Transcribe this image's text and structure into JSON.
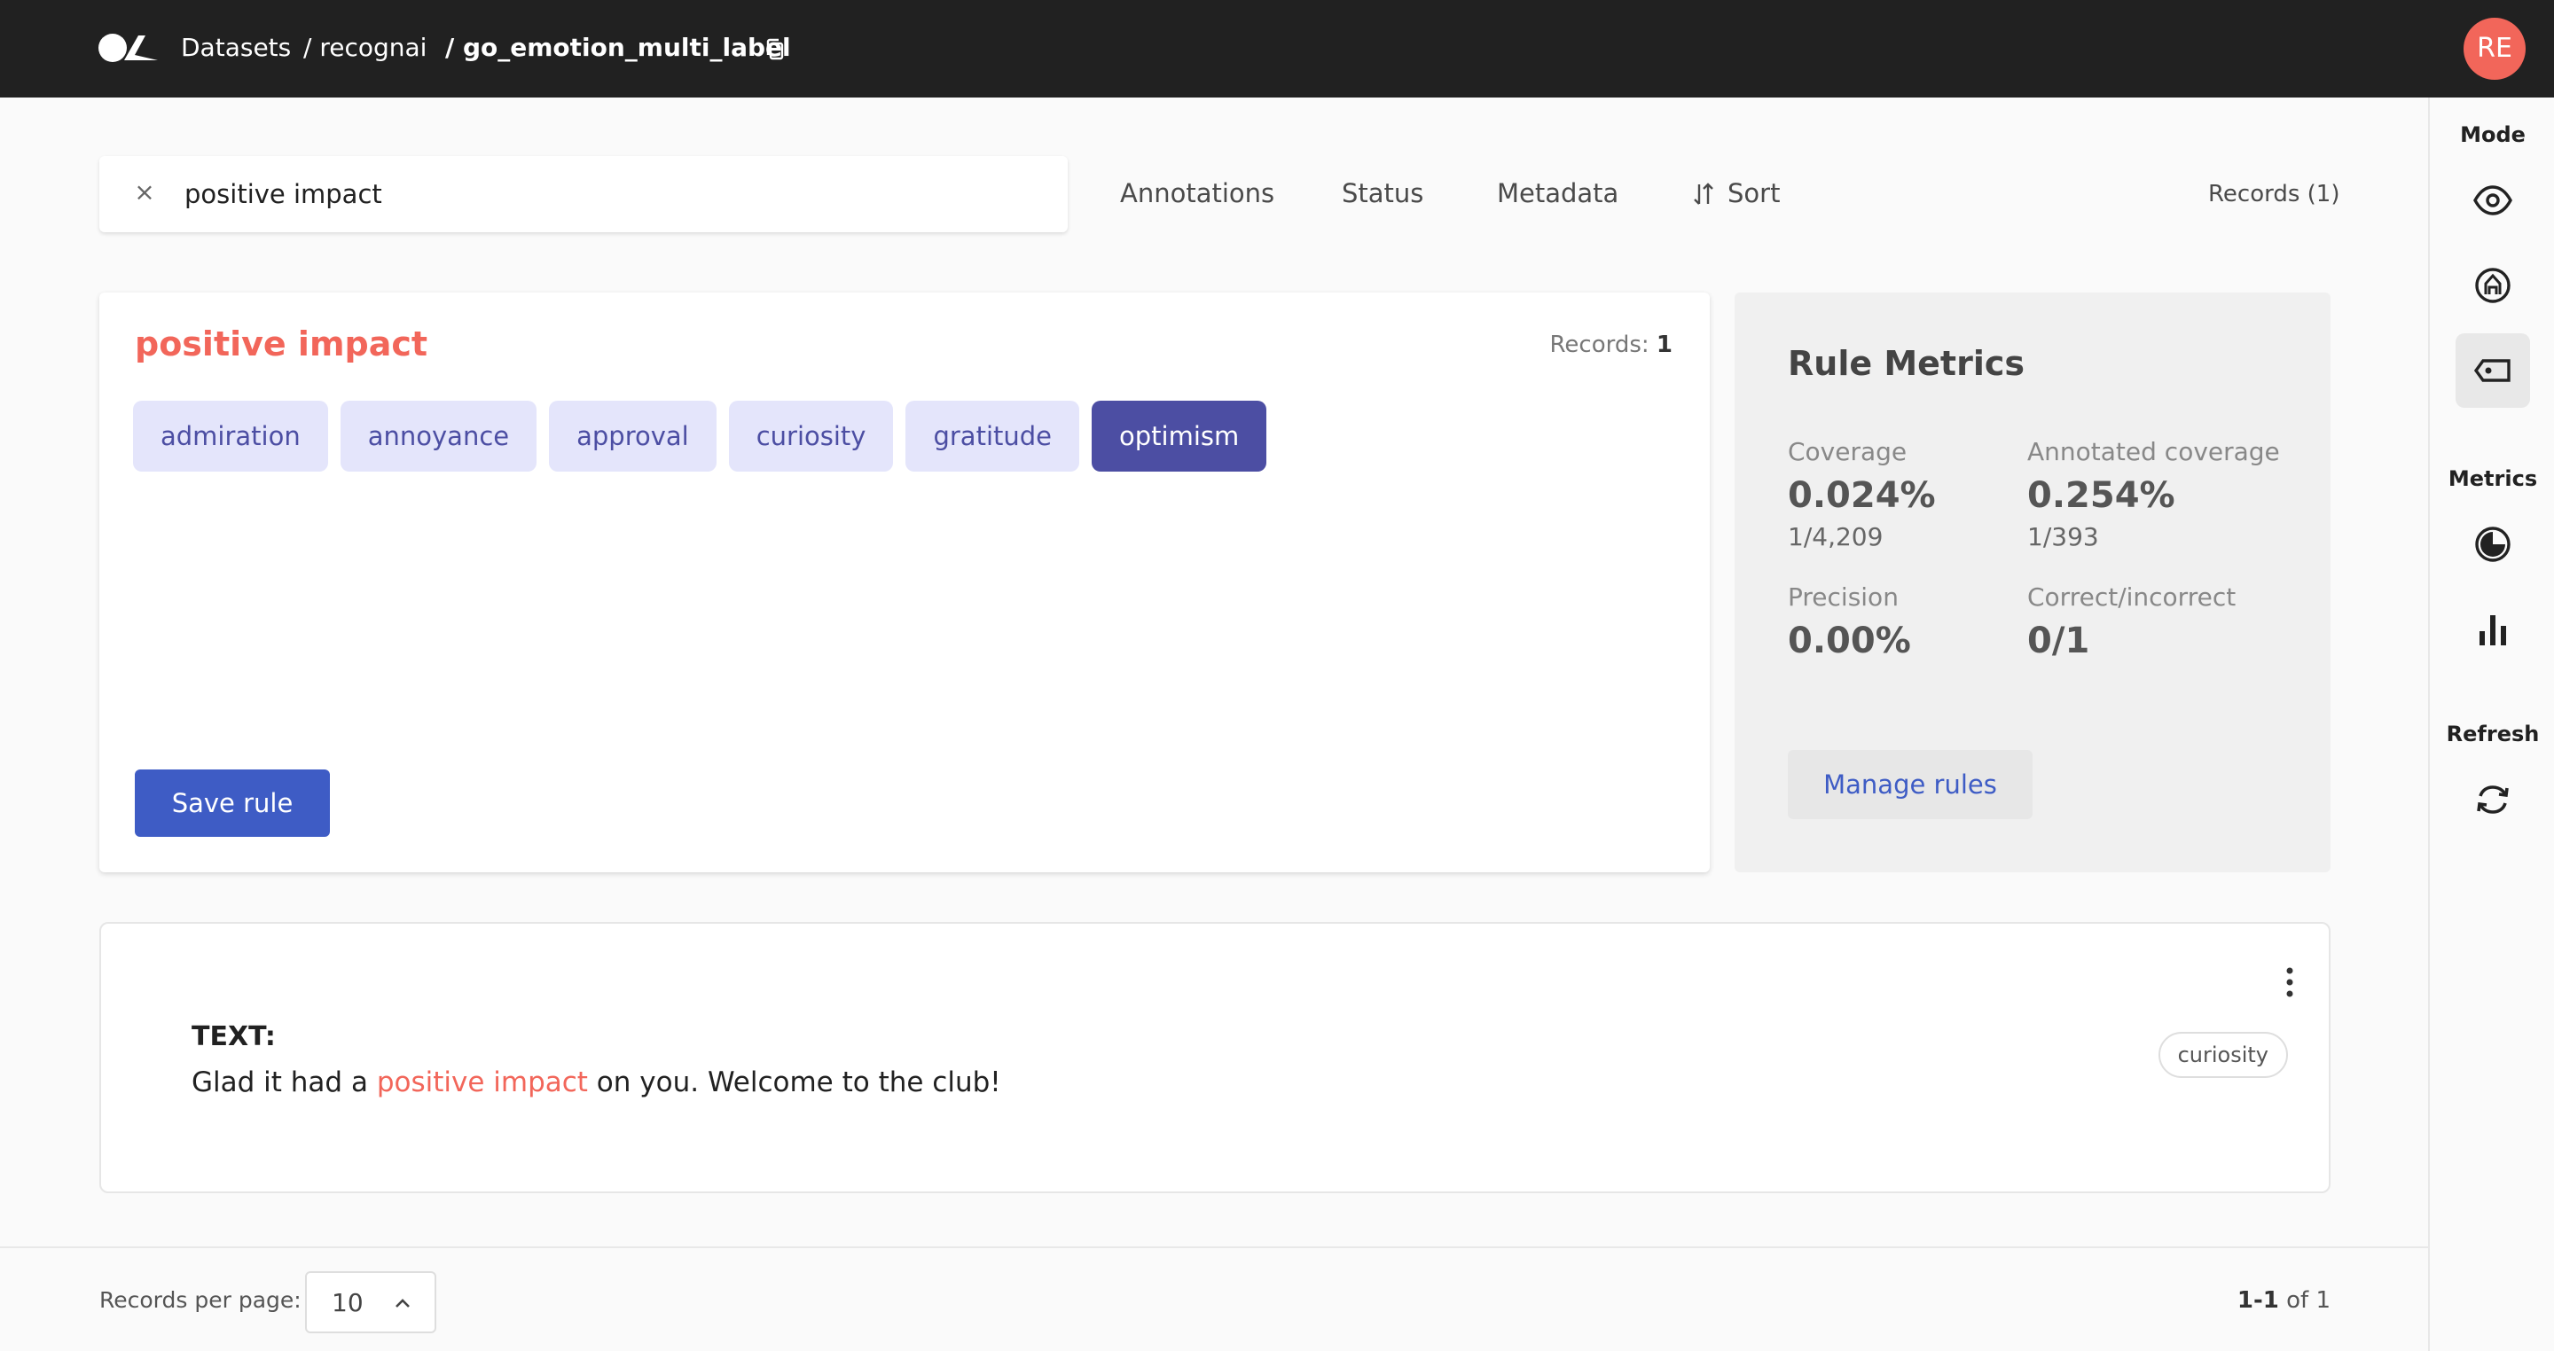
{
  "header": {
    "breadcrumb": [
      {
        "label": "Datasets"
      },
      {
        "label": "/ recognai"
      },
      {
        "label": "/ go_emotion_multi_label"
      }
    ],
    "avatar_initials": "RE"
  },
  "search": {
    "query": "positive impact",
    "clear_icon": "close-icon"
  },
  "filters": {
    "annotations": "Annotations",
    "status": "Status",
    "metadata": "Metadata",
    "sort": "Sort",
    "records_count": "Records (1)"
  },
  "rule": {
    "title": "positive impact",
    "records_label": "Records:",
    "records_value": "1",
    "labels": [
      {
        "label": "admiration",
        "selected": false
      },
      {
        "label": "annoyance",
        "selected": false
      },
      {
        "label": "approval",
        "selected": false
      },
      {
        "label": "curiosity",
        "selected": false
      },
      {
        "label": "gratitude",
        "selected": false
      },
      {
        "label": "optimism",
        "selected": true
      }
    ],
    "save_label": "Save rule"
  },
  "metrics": {
    "title": "Rule Metrics",
    "coverage_label": "Coverage",
    "coverage_value": "0.024%",
    "coverage_sub": "1/4,209",
    "annotated_coverage_label": "Annotated coverage",
    "annotated_coverage_value": "0.254%",
    "annotated_coverage_sub": "1/393",
    "precision_label": "Precision",
    "precision_value": "0.00%",
    "correct_label": "Correct/incorrect",
    "correct_value": "0/1",
    "manage_label": "Manage rules"
  },
  "record": {
    "key": "TEXT:",
    "text_before": "Glad it had a ",
    "text_highlight": "positive impact",
    "text_after": " on you. Welcome to the club!",
    "annotation_tag": "curiosity"
  },
  "sidebar": {
    "mode_label": "Mode",
    "metrics_label": "Metrics",
    "refresh_label": "Refresh",
    "active_mode": "weak-labelling"
  },
  "footer": {
    "rpp_label": "Records per page:",
    "rpp_value": "10",
    "range": "1-1",
    "of_text": "of 1"
  },
  "colors": {
    "accent": "#f2665a",
    "primary": "#3e5cc5",
    "tag_bg": "#e4e5fb",
    "tag_text": "#4c4ea3",
    "topbar": "#212121"
  }
}
